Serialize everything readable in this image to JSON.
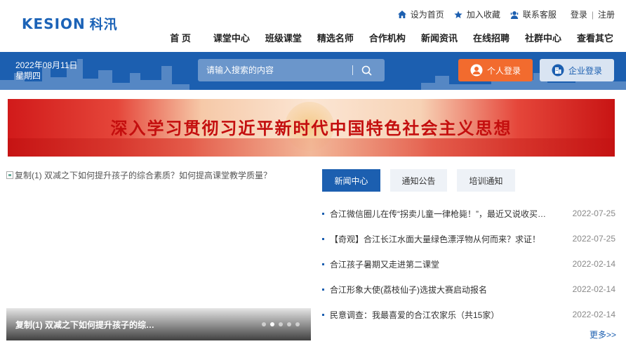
{
  "logo": {
    "en": "KESION",
    "cn": "科汛"
  },
  "top_links": {
    "homepage": "设为首页",
    "favorite": "加入收藏",
    "service": "联系客服",
    "login": "登录",
    "sep": "|",
    "register": "注册"
  },
  "nav": [
    "首 页",
    "课堂中心",
    "班级课堂",
    "精选名师",
    "合作机构",
    "新闻资讯",
    "在线招聘",
    "社群中心",
    "查看其它"
  ],
  "bar": {
    "date": "2022年08月11日",
    "weekday": "星期四",
    "search_placeholder": "请输入搜索的内容",
    "person_login": "个人登录",
    "company_login": "企业登录"
  },
  "banner": {
    "text": "深入学习贯彻习近平新时代中国特色社会主义思想"
  },
  "slider": {
    "alt_text": "复制(1) 双减之下如何提升孩子的综合素质？如何提高课堂教学质量？",
    "caption": "复制(1) 双减之下如何提升孩子的综合素质？如何提高课堂教学质量？",
    "active_index": 1,
    "dot_count": 5
  },
  "tabs": [
    "新闻中心",
    "通知公告",
    "培训通知"
  ],
  "news": [
    {
      "title": "合江微信圈儿在传“拐卖儿童一律枪毙！”，最近又说收买被拐卖儿童",
      "date": "2022-07-25"
    },
    {
      "title": "【奇观】合江长江水面大量绿色漂浮物从何而来？求证！",
      "date": "2022-07-25"
    },
    {
      "title": "合江孩子暑期又走进第二课堂",
      "date": "2022-02-14"
    },
    {
      "title": "合江形象大使(荔枝仙子)选拔大赛启动报名",
      "date": "2022-02-14"
    },
    {
      "title": "民意调查：我最喜爱的合江农家乐（共15家）",
      "date": "2022-02-14"
    }
  ],
  "more": "更多>>",
  "colors": {
    "brand": "#1c5fb0",
    "orange": "#f26b2e",
    "banner_red": "#c40e0e"
  }
}
